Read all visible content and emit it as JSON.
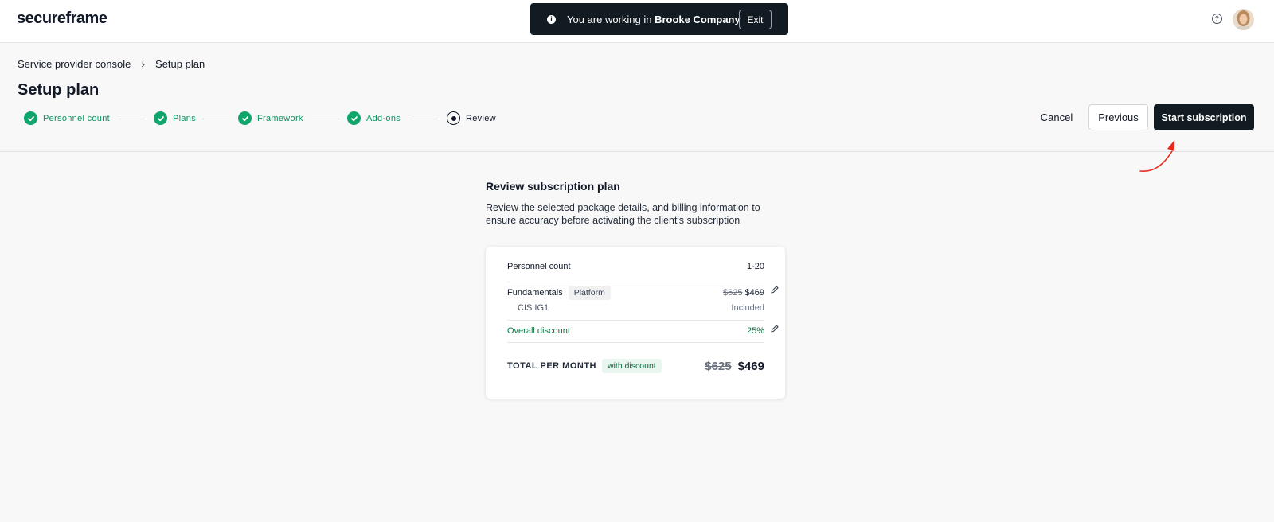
{
  "app": {
    "logo": "secureframe"
  },
  "banner": {
    "prefix": "You are working in ",
    "company": "Brooke Company",
    "exit_label": "Exit",
    "info_icon": "info-icon"
  },
  "header": {
    "help_icon": "help-icon",
    "avatar": "user-avatar"
  },
  "breadcrumb": [
    {
      "label": "Service provider console"
    },
    {
      "label": "Setup plan"
    }
  ],
  "page": {
    "title": "Setup plan"
  },
  "stepper": {
    "steps": [
      {
        "label": "Personnel count",
        "status": "complete"
      },
      {
        "label": "Plans",
        "status": "complete"
      },
      {
        "label": "Framework",
        "status": "complete"
      },
      {
        "label": "Add-ons",
        "status": "complete"
      },
      {
        "label": "Review",
        "status": "current"
      }
    ]
  },
  "actions": {
    "cancel": "Cancel",
    "previous": "Previous",
    "start": "Start subscription"
  },
  "review": {
    "title": "Review subscription plan",
    "description": "Review the selected package details, and billing information to ensure accuracy before activating the client's subscription"
  },
  "summary": {
    "personnel_label": "Personnel count",
    "personnel_value": "1-20",
    "plan_name": "Fundamentals",
    "plan_tag": "Platform",
    "plan_old_price": "$625",
    "plan_new_price": "$469",
    "framework_name": "CIS IG1",
    "framework_value": "Included",
    "discount_label": "Overall discount",
    "discount_value": "25%",
    "total_label": "TOTAL PER MONTH",
    "total_tag": "with discount",
    "total_old": "$625",
    "total_new": "$469"
  },
  "colors": {
    "accent_green": "#10a56b",
    "dark": "#121a22",
    "annotation_red": "#e8281c"
  }
}
